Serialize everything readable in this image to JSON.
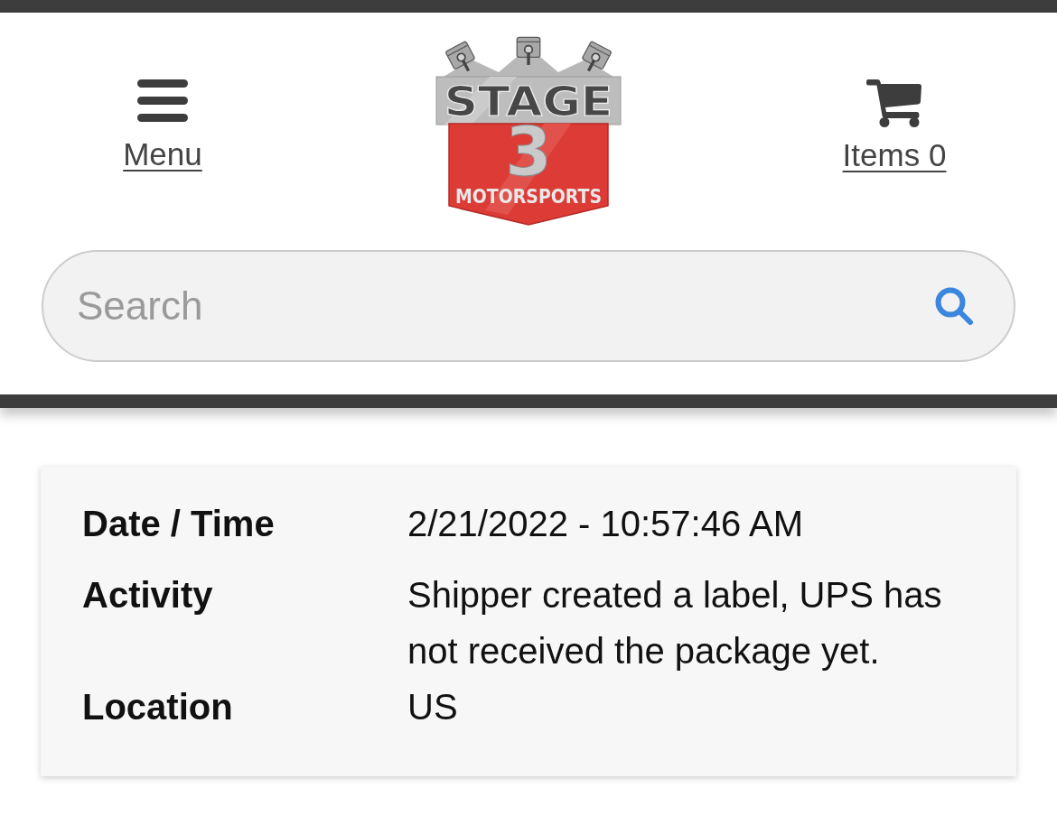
{
  "header": {
    "menu": {
      "label": "Menu"
    },
    "logo": {
      "wordmark": "STAGE",
      "numeral": "3",
      "tagline": "MOTORSPORTS"
    },
    "cart": {
      "label": "Items 0"
    }
  },
  "search": {
    "placeholder": "Search"
  },
  "tracking": {
    "rows": [
      {
        "label": "Date / Time",
        "value": "2/21/2022 - 10:57:46 AM"
      },
      {
        "label": "Activity",
        "value": "Shipper created a label, UPS has not received the package yet."
      },
      {
        "label": "Location",
        "value": "US"
      }
    ]
  }
}
